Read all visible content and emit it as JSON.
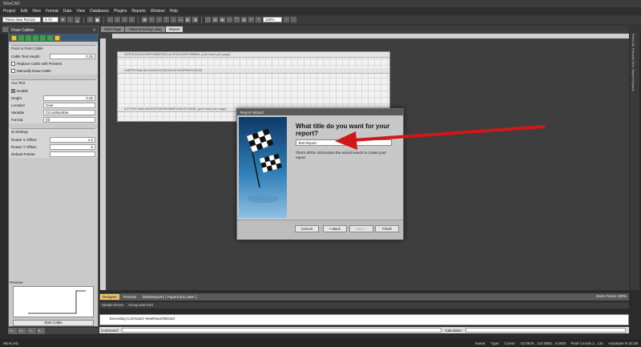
{
  "window": {
    "title": "WireCAD"
  },
  "menu": [
    "Project",
    "Edit",
    "View",
    "Format",
    "Data",
    "View",
    "Databases",
    "Plugins",
    "Reports",
    "Window",
    "Help"
  ],
  "toolbar": {
    "font": "Times New Roman",
    "font_size": "9.75",
    "zoom": "100%"
  },
  "left_panel": {
    "title": "Draw Cables",
    "section_title": "Point to Point Cable",
    "cable_text_height_label": "Cable Text Height:",
    "cable_text_height_value": "0.25",
    "replace_cable_label": "Replace Cable with Pointers",
    "manually_draw_label": "Manually Draw Cable",
    "aux_text_label": "Aux Text",
    "enable_label": "Enable",
    "height_label": "Height",
    "height_value": "0.25",
    "location_label": "Location",
    "location_value": "Over",
    "variable_label": "Variable",
    "variable_value": "CircuitNumber",
    "format_label": "Format",
    "format_value": "{0}",
    "settings_label": "Settings",
    "router_x_label": "Router X Offset:",
    "router_x_value": "1.5",
    "router_y_label": "Router Y Offset:",
    "router_y_value": "5",
    "default_pointer_label": "Default Pointer:",
    "preview_label": "Preview:",
    "start_cable_label": "Start Cable",
    "bottom_tabs": [
      "Pr...",
      "Dr...",
      "O...",
      "B..."
    ]
  },
  "doc_tabs": [
    "Start Page",
    "<New Drawing>.dwg",
    "Report"
  ],
  "report_bands": [
    "IGRPEJNGACKNPCBMEFBCULOFKGOMPCBBBNL [one band per page]",
    "HHEPKGNAJALKNHDHOHEENCNFJHHPNHHCBUM",
    "ILFCPECNMLANGEDFNKEBUMNPLNKUFLNDBL [one band per page]"
  ],
  "wizard": {
    "title": "Report Wizard",
    "heading": "What title do you want for your report?",
    "input_value": "Test Report",
    "info": "That's all the information the wizard needs to create your report.",
    "cancel": "Cancel",
    "back": "< Back",
    "next": "Next >",
    "finish": "Finish"
  },
  "designer_tabs": [
    "Designer",
    "Preview",
    "blankReport1 { PaperKind.Letter }"
  ],
  "zoom_factor": "Zoom Factor 100%",
  "bottom_tabs": [
    "Simple Errors",
    "Group and Sort"
  ],
  "command_output": "Executing Command: NewReportWizard",
  "command_label": "Command:",
  "calculator_label": "Calculator:",
  "right_strip": [
    "Field List",
    "Property Grid",
    "Report Explorer"
  ],
  "status": {
    "app": "WireCAD",
    "name": "Name:",
    "type": "Type:",
    "comm": "Comm",
    "coords": "-22.0676 , 143.0683 , 0.0000",
    "pixel_coords": "Pixel Coords 1 , 131",
    "autosave": "AutoSave In 01:28"
  },
  "colors": {
    "accent": "#f0c36a",
    "arrow": "#d01818",
    "dialog_image": "#2f7fb8"
  }
}
